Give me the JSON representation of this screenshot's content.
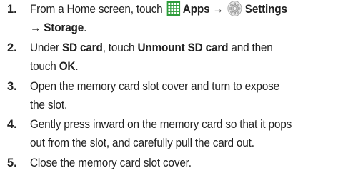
{
  "steps": [
    {
      "number": "1.",
      "line1_pre": "From a Home screen, touch",
      "apps_icon": "apps-grid-icon",
      "apps_label": "Apps",
      "arrow1": "→",
      "settings_icon": "settings-gear-icon",
      "settings_label": "Settings",
      "arrow2": "→",
      "storage_label": "Storage",
      "period": "."
    },
    {
      "number": "2.",
      "pre": "Under ",
      "sd_card": "SD card",
      "mid": ", touch ",
      "unmount": "Unmount SD card",
      "post": " and then",
      "line2_pre": "touch ",
      "ok": "OK",
      "period": "."
    },
    {
      "number": "3.",
      "line1": "Open the memory card slot cover and turn to expose",
      "line2": "the slot."
    },
    {
      "number": "4.",
      "line1": "Gently press inward on the memory card so that it pops",
      "line2": "out from the slot, and carefully pull the card out."
    },
    {
      "number": "5.",
      "line1": "Close the memory card slot cover."
    }
  ],
  "colors": {
    "apps_icon": "#2e9c3a",
    "text": "#222222"
  }
}
